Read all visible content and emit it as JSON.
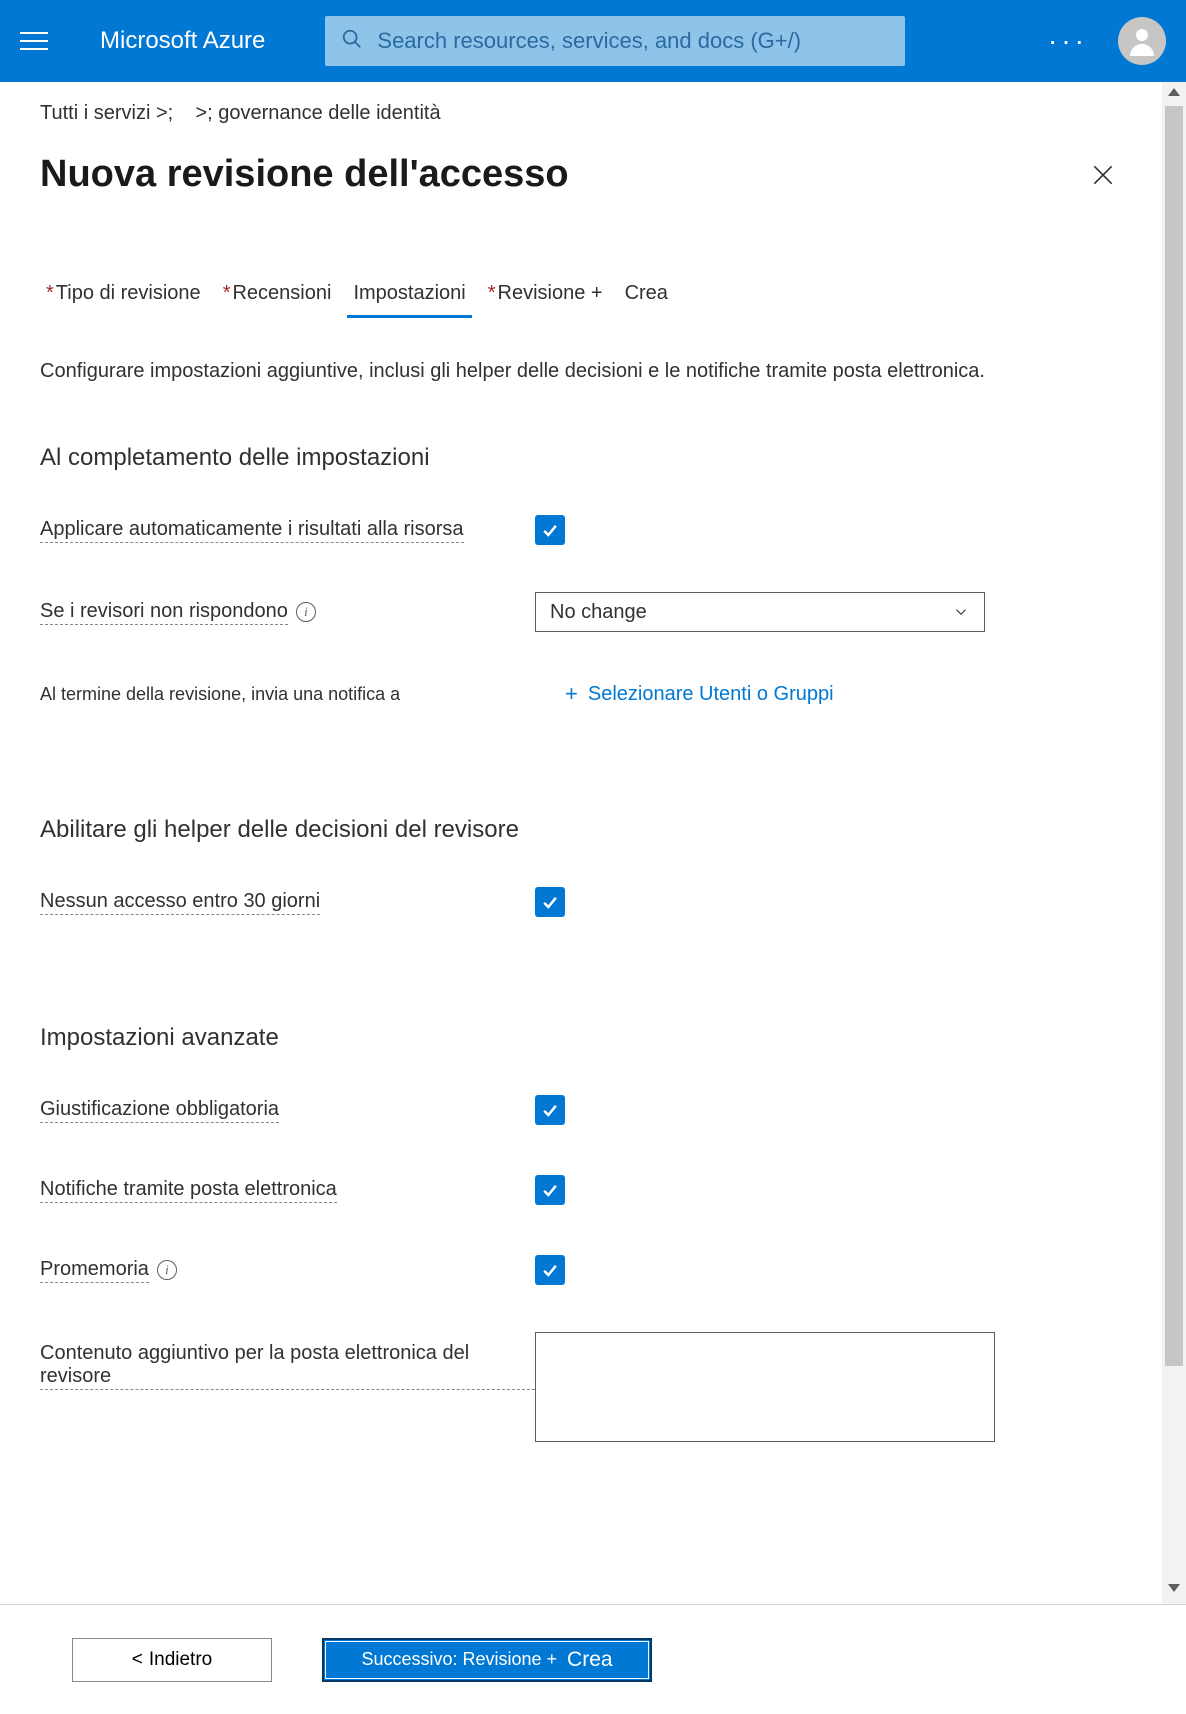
{
  "topbar": {
    "brand": "Microsoft Azure",
    "search_placeholder": "Search resources, services, and docs (G+/)"
  },
  "breadcrumb": {
    "item1": "Tutti i servizi >;",
    "item2": ">; governance delle identità"
  },
  "page": {
    "title": "Nuova revisione dell'accesso"
  },
  "tabs": {
    "t1": "Tipo di revisione",
    "t2": "Recensioni",
    "t3": "Impostazioni",
    "t4": "Revisione +",
    "t5": "Crea"
  },
  "desc": "Configurare impostazioni aggiuntive, inclusi gli helper delle decisioni e le notifiche tramite posta elettronica.",
  "sections": {
    "completion": {
      "title": "Al completamento delle impostazioni",
      "auto_apply": "Applicare automaticamente i risultati alla risorsa",
      "no_respond": "Se i revisori non rispondono",
      "no_respond_value": "No change",
      "notify_end": "Al termine della revisione, invia una notifica a",
      "select_users": "Selezionare Utenti o Gruppi"
    },
    "helpers": {
      "title": "Abilitare gli helper delle decisioni del revisore",
      "no_signin": "Nessun accesso entro 30 giorni"
    },
    "advanced": {
      "title": "Impostazioni avanzate",
      "justification": "Giustificazione obbligatoria",
      "email_notif": "Notifiche tramite posta elettronica",
      "reminders": "Promemoria",
      "extra_email": "Contenuto aggiuntivo per la posta elettronica del revisore"
    }
  },
  "footer": {
    "back": "Indietro",
    "next_prefix": "Successivo: Revisione +",
    "next_crea": "Crea"
  }
}
